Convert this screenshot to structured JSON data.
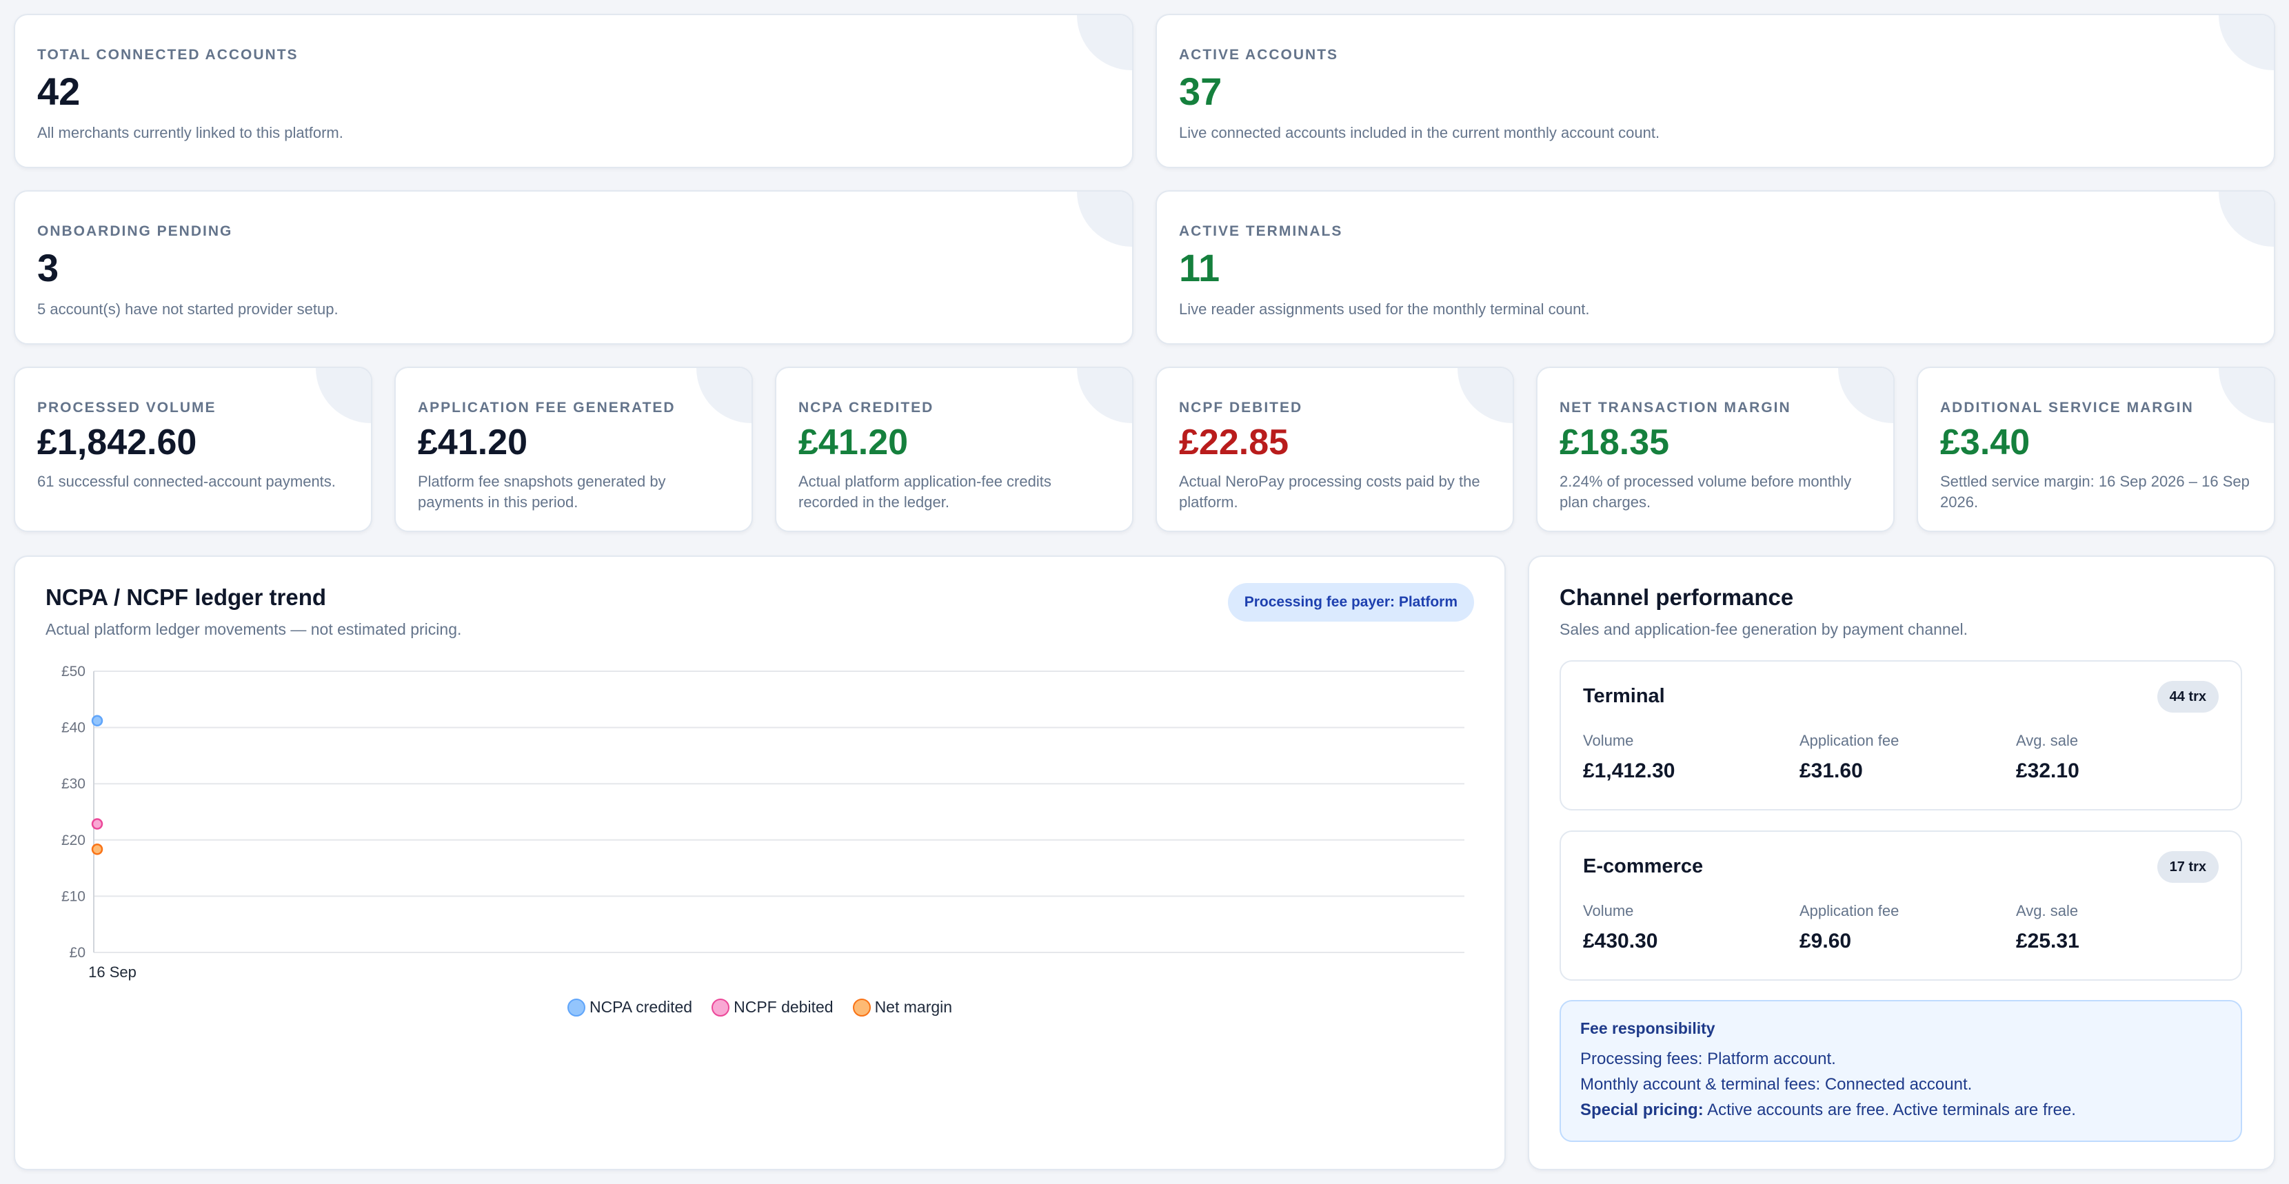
{
  "top_stats": [
    {
      "label": "TOTAL CONNECTED ACCOUNTS",
      "value": "42",
      "desc": "All merchants currently linked to this platform."
    },
    {
      "label": "ACTIVE ACCOUNTS",
      "value": "37",
      "desc": "Live connected accounts included in the current monthly account count."
    },
    {
      "label": "ONBOARDING PENDING",
      "value": "3",
      "desc": "5 account(s) have not started provider setup."
    },
    {
      "label": "ACTIVE TERMINALS",
      "value": "11",
      "desc": "Live reader assignments used for the monthly terminal count."
    }
  ],
  "finance_stats": [
    {
      "label": "PROCESSED VOLUME",
      "value": "£1,842.60",
      "desc": "61 successful connected-account payments."
    },
    {
      "label": "APPLICATION FEE GENERATED",
      "value": "£41.20",
      "desc": "Platform fee snapshots generated by payments in this period."
    },
    {
      "label": "NCPA CREDITED",
      "value": "£41.20",
      "desc": "Actual platform application-fee credits recorded in the ledger."
    },
    {
      "label": "NCPF DEBITED",
      "value": "£22.85",
      "desc": "Actual NeroPay processing costs paid by the platform."
    },
    {
      "label": "NET TRANSACTION MARGIN",
      "value": "£18.35",
      "desc": "2.24% of processed volume before monthly plan charges."
    },
    {
      "label": "ADDITIONAL SERVICE MARGIN",
      "value": "£3.40",
      "desc": "Settled service margin: 16 Sep 2026 – 16 Sep 2026."
    }
  ],
  "colors": {
    "positive": "#15803d",
    "negative": "#b91c1c",
    "neutral": "#0f172a"
  },
  "trend": {
    "title": "NCPA / NCPF ledger trend",
    "subtitle": "Actual platform ledger movements — not estimated pricing.",
    "payer_badge": "Processing fee payer: Platform"
  },
  "chart_data": {
    "type": "scatter",
    "title": "NCPA / NCPF ledger trend",
    "xlabel": "",
    "ylabel": "",
    "x": [
      "16 Sep"
    ],
    "ylim": [
      0,
      50
    ],
    "y_ticks": [
      "£0",
      "£10",
      "£20",
      "£30",
      "£40",
      "£50"
    ],
    "grid": true,
    "legend_position": "bottom",
    "series": [
      {
        "name": "NCPA credited",
        "values": [
          41.2
        ],
        "color": "#60a5fa",
        "fill": "#93c5fd"
      },
      {
        "name": "NCPF debited",
        "values": [
          22.85
        ],
        "color": "#ec4899",
        "fill": "#f9a8d4"
      },
      {
        "name": "Net margin",
        "values": [
          18.35
        ],
        "color": "#f97316",
        "fill": "#fdba74"
      }
    ]
  },
  "channels": {
    "title": "Channel performance",
    "subtitle": "Sales and application-fee generation by payment channel.",
    "items": [
      {
        "name": "Terminal",
        "badge": "44 trx",
        "volume_label": "Volume",
        "volume": "£1,412.30",
        "fee_label": "Application fee",
        "fee": "£31.60",
        "avg_label": "Avg. sale",
        "avg": "£32.10"
      },
      {
        "name": "E-commerce",
        "badge": "17 trx",
        "volume_label": "Volume",
        "volume": "£430.30",
        "fee_label": "Application fee",
        "fee": "£9.60",
        "avg_label": "Avg. sale",
        "avg": "£25.31"
      }
    ]
  },
  "fees": {
    "title": "Fee responsibility",
    "line1": "Processing fees: Platform account.",
    "line2": "Monthly account & terminal fees: Connected account.",
    "special_label": "Special pricing:",
    "special_text": " Active accounts are free. Active terminals are free."
  }
}
